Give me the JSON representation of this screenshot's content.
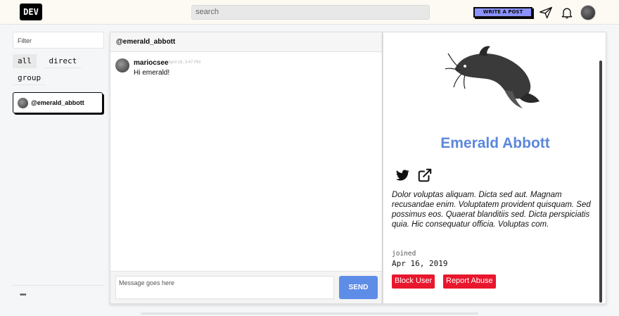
{
  "header": {
    "logo": "DEV",
    "search_placeholder": "search",
    "write_post": "WRITE A POST"
  },
  "sidebar": {
    "filter_placeholder": "Filter",
    "tabs": [
      "all",
      "direct",
      "group"
    ],
    "active_tab": "all",
    "conversations": [
      {
        "name": "@emerald_abbott"
      }
    ],
    "more": "•••"
  },
  "chat": {
    "channel_title": "@emerald_abbott",
    "messages": [
      {
        "user": "mariocsee",
        "time": "April 16, 3:47 PM",
        "text": "Hi emerald!"
      }
    ],
    "composer_placeholder": "Message goes here",
    "send_label": "SEND"
  },
  "profile": {
    "name": "Emerald Abbott",
    "bio": "Dolor voluptas aliquam. Dicta sed aut. Magnam recusandae enim. Voluptatem provident quisquam. Sed possimus eos. Quaerat blanditiis sed. Dicta perspiciatis quia. Hic consequatur officia. Voluptas com.",
    "joined_label": "joined",
    "joined_date": "Apr 16, 2019",
    "block_label": "Block User",
    "report_label": "Report Abuse"
  },
  "colors": {
    "accent_blue": "#5e8de8",
    "name_blue": "#5b87dc",
    "danger_red": "#e8172d"
  }
}
